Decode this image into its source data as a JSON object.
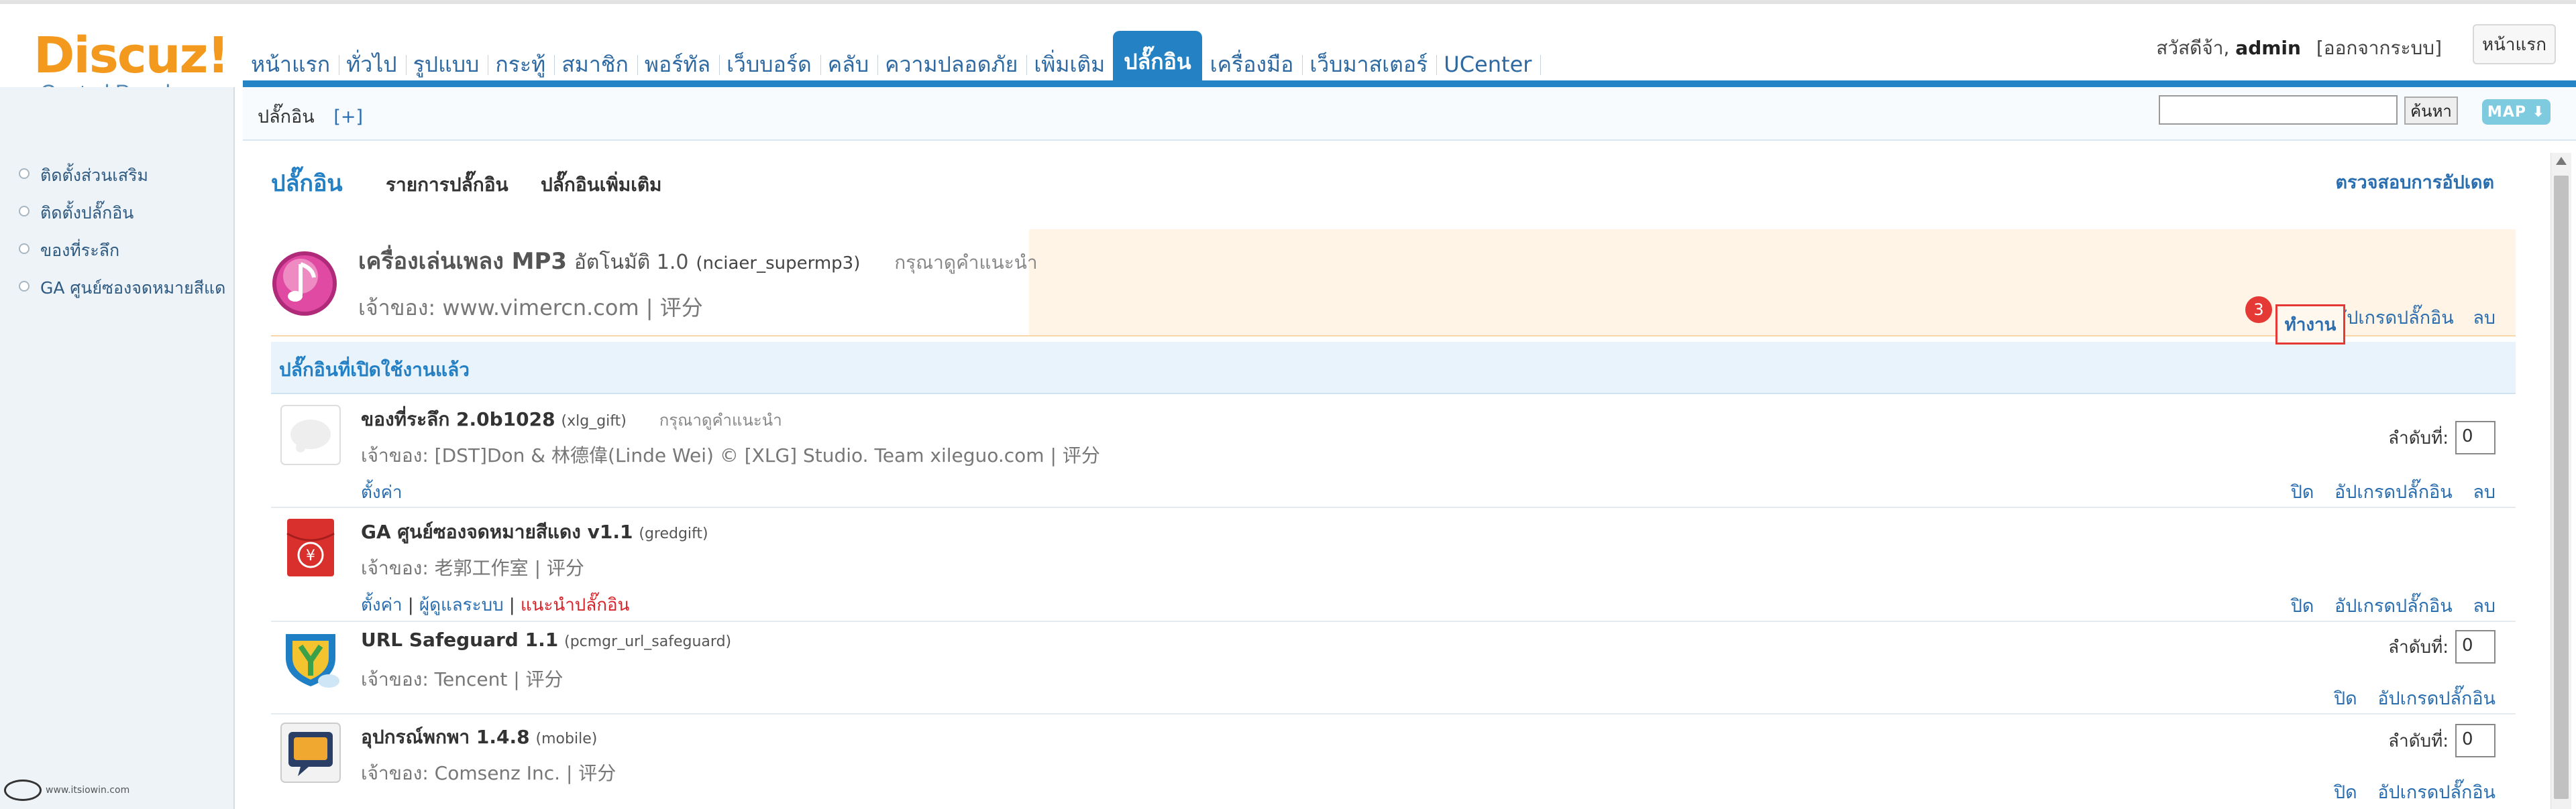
{
  "logo": {
    "brand": "Discuz!",
    "sub": "Control Panel"
  },
  "nav": [
    {
      "label": "หน้าแรก"
    },
    {
      "label": "ทั่วไป"
    },
    {
      "label": "รูปแบบ"
    },
    {
      "label": "กระทู้"
    },
    {
      "label": "สมาชิก"
    },
    {
      "label": "พอร์ทัล"
    },
    {
      "label": "เว็บบอร์ด"
    },
    {
      "label": "คลับ"
    },
    {
      "label": "ความปลอดภัย"
    },
    {
      "label": "เพิ่มเติม"
    },
    {
      "label": "ปลั๊กอิน"
    },
    {
      "label": "เครื่องมือ"
    },
    {
      "label": "เว็บมาสเตอร์"
    },
    {
      "label": "UCenter"
    }
  ],
  "user": {
    "greeting": "สวัสดีจ้า,",
    "name": "admin",
    "logout": "[ออกจากระบบ]",
    "home_button": "หน้าแรก"
  },
  "subbar": {
    "crumb": "ปลั๊กอิน",
    "plus": "[+]",
    "search_button": "ค้นหา",
    "map_button": "MAP ⬇"
  },
  "sidebar": {
    "items": [
      {
        "label": "ติดตั้งส่วนเสริม"
      },
      {
        "label": "ติดตั้งปลั๊กอิน"
      },
      {
        "label": "ของที่ระลึก"
      },
      {
        "label": "GA ศูนย์ซองจดหมายสีแด"
      }
    ],
    "footer": "www.itsiowin.com"
  },
  "main": {
    "tab_title": "ปลั๊กอิน",
    "tabs": [
      {
        "label": "รายการปลั๊กอิน"
      },
      {
        "label": "ปลั๊กอินเพิ่มเติม"
      }
    ],
    "check_update": "ตรวจสอบการอัปเดต",
    "new_plugin": {
      "name": "เครื่องเล่นเพลง MP3",
      "subtitle": "อัตโนมัติ 1.0",
      "id": "(nciaer_supermp3)",
      "hint": "กรุณาดูคำแนะนำ",
      "owner": "เจ้าของ: www.vimercn.com | 评分",
      "action_enable": "ทำงาน",
      "action_upgrade": "อัปเกรดปลั๊กอิน",
      "action_delete": "ลบ",
      "step": "3"
    },
    "section_title": "ปลั๊กอินที่เปิดใช้งานแล้ว",
    "plugins": [
      {
        "name": "ของที่ระลึก 2.0b1028",
        "id": "(xlg_gift)",
        "hint": "กรุณาดูคำแนะนำ",
        "owner": "เจ้าของ: [DST]Don & 林德偉(Linde Wei) © [XLG] Studio. Team xileguo.com | 评分",
        "link1": "ตั้งค่า",
        "link2": "",
        "link3": "",
        "order_label": "ลำดับที่:",
        "order_value": "0",
        "act_close": "ปิด",
        "act_upgrade": "อัปเกรดปลั๊กอิน",
        "act_delete": "ลบ"
      },
      {
        "name": "GA ศูนย์ซองจดหมายสีแดง v1.1",
        "id": "(gredgift)",
        "hint": "",
        "owner": "เจ้าของ: 老郭工作室 | 评分",
        "link1": "ตั้งค่า",
        "link2": "ผู้ดูแลระบบ",
        "link3": "แนะนำปลั๊กอิน",
        "order_label": "",
        "order_value": "",
        "act_close": "ปิด",
        "act_upgrade": "อัปเกรดปลั๊กอิน",
        "act_delete": "ลบ"
      },
      {
        "name": "URL Safeguard 1.1",
        "id": "(pcmgr_url_safeguard)",
        "hint": "",
        "owner": "เจ้าของ: Tencent | 评分",
        "order_label": "ลำดับที่:",
        "order_value": "0",
        "act_close": "ปิด",
        "act_upgrade": "อัปเกรดปลั๊กอิน"
      },
      {
        "name": "อุปกรณ์พกพา 1.4.8",
        "id": "(mobile)",
        "hint": "",
        "owner": "เจ้าของ: Comsenz Inc. | 评分",
        "order_label": "ลำดับที่:",
        "order_value": "0",
        "act_close": "ปิด",
        "act_upgrade": "อัปเกรดปลั๊กอิน"
      }
    ]
  },
  "colors": {
    "accent": "#2584c6",
    "logo": "#f39a1e",
    "highlight": "#e53935",
    "new_row_bg": "#fff4e6"
  }
}
